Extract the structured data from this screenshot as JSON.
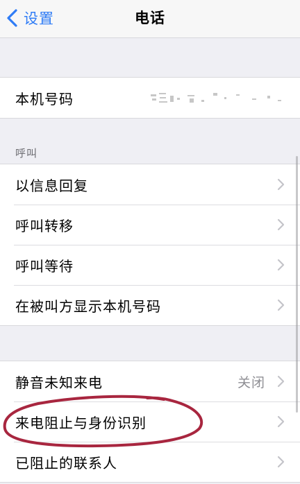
{
  "navbar": {
    "back_label": "设置",
    "title": "电话"
  },
  "my_number": {
    "label": "本机号码",
    "value_obscured": true
  },
  "calls_section": {
    "header": "呼叫",
    "items": [
      {
        "label": "以信息回复"
      },
      {
        "label": "呼叫转移"
      },
      {
        "label": "呼叫等待"
      },
      {
        "label": "在被叫方显示本机号码"
      }
    ]
  },
  "other_section": {
    "items": [
      {
        "label": "静音未知来电",
        "value": "关闭"
      },
      {
        "label": "来电阻止与身份识别",
        "highlighted": true
      },
      {
        "label": "已阻止的联系人"
      }
    ]
  },
  "colors": {
    "accent": "#2f7cf6",
    "background": "#efeff4",
    "annotation": "#a8263f"
  },
  "icons": [
    "chevron-left-icon",
    "chevron-right-icon"
  ]
}
